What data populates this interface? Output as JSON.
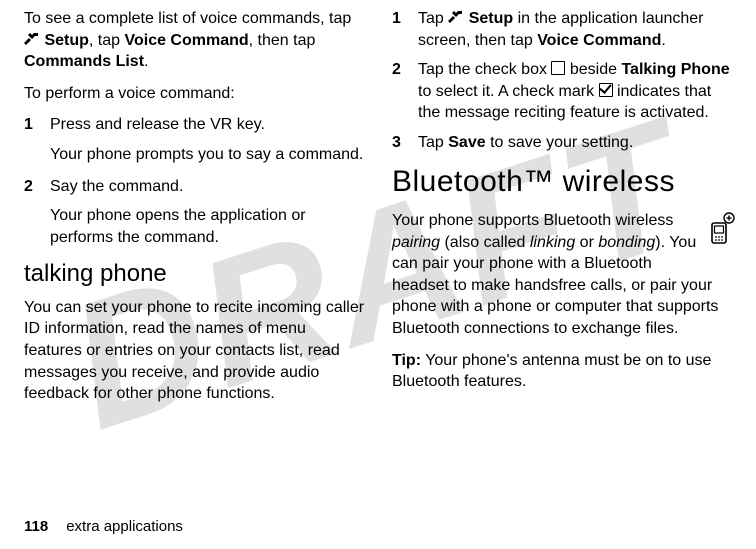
{
  "watermark": "DRAFT",
  "left": {
    "intro1_a": "To see a complete list of voice commands, tap ",
    "intro1_setup": "Setup",
    "intro1_b": ", tap ",
    "intro1_vc": "Voice Command",
    "intro1_c": ", then tap ",
    "intro1_cl": "Commands List",
    "intro1_d": ".",
    "perform": "To perform a voice command:",
    "step1_num": "1",
    "step1": "Press and release the VR key.",
    "step1_sub": "Your phone prompts you to say a command.",
    "step2_num": "2",
    "step2": "Say the command.",
    "step2_sub": "Your phone opens the application or performs the command.",
    "subhead": "talking phone",
    "para2": "You can set your phone to recite incoming caller ID information, read the names of menu features or entries on your contacts list, read messages you receive, and provide audio feedback for other phone functions."
  },
  "right": {
    "step1_num": "1",
    "step1_a": "Tap ",
    "step1_setup": "Setup",
    "step1_b": " in the application launcher screen, then tap ",
    "step1_vc": "Voice Command",
    "step1_c": ".",
    "step2_num": "2",
    "step2_a": "Tap the check box ",
    "step2_b": " beside ",
    "step2_tp": "Talking Phone",
    "step2_c": " to select it. A check mark ",
    "step2_d": " indicates that the message reciting feature is activated.",
    "step3_num": "3",
    "step3_a": "Tap ",
    "step3_save": "Save",
    "step3_b": " to save your setting.",
    "bighead": "Bluetooth™ wireless",
    "bt_a": "Your phone supports Bluetooth wireless ",
    "bt_pairing": "pairing",
    "bt_b": " (also called ",
    "bt_linking": "linking",
    "bt_c": " or ",
    "bt_bonding": "bonding",
    "bt_d": "). You can pair your phone with a Bluetooth headset to make handsfree calls, or pair your phone with a phone or computer that supports Bluetooth connections to exchange files.",
    "tip_label": "Tip:",
    "tip_body": " Your phone's antenna must be on to use Bluetooth features."
  },
  "footer": {
    "page_number": "118",
    "section": "extra applications"
  }
}
